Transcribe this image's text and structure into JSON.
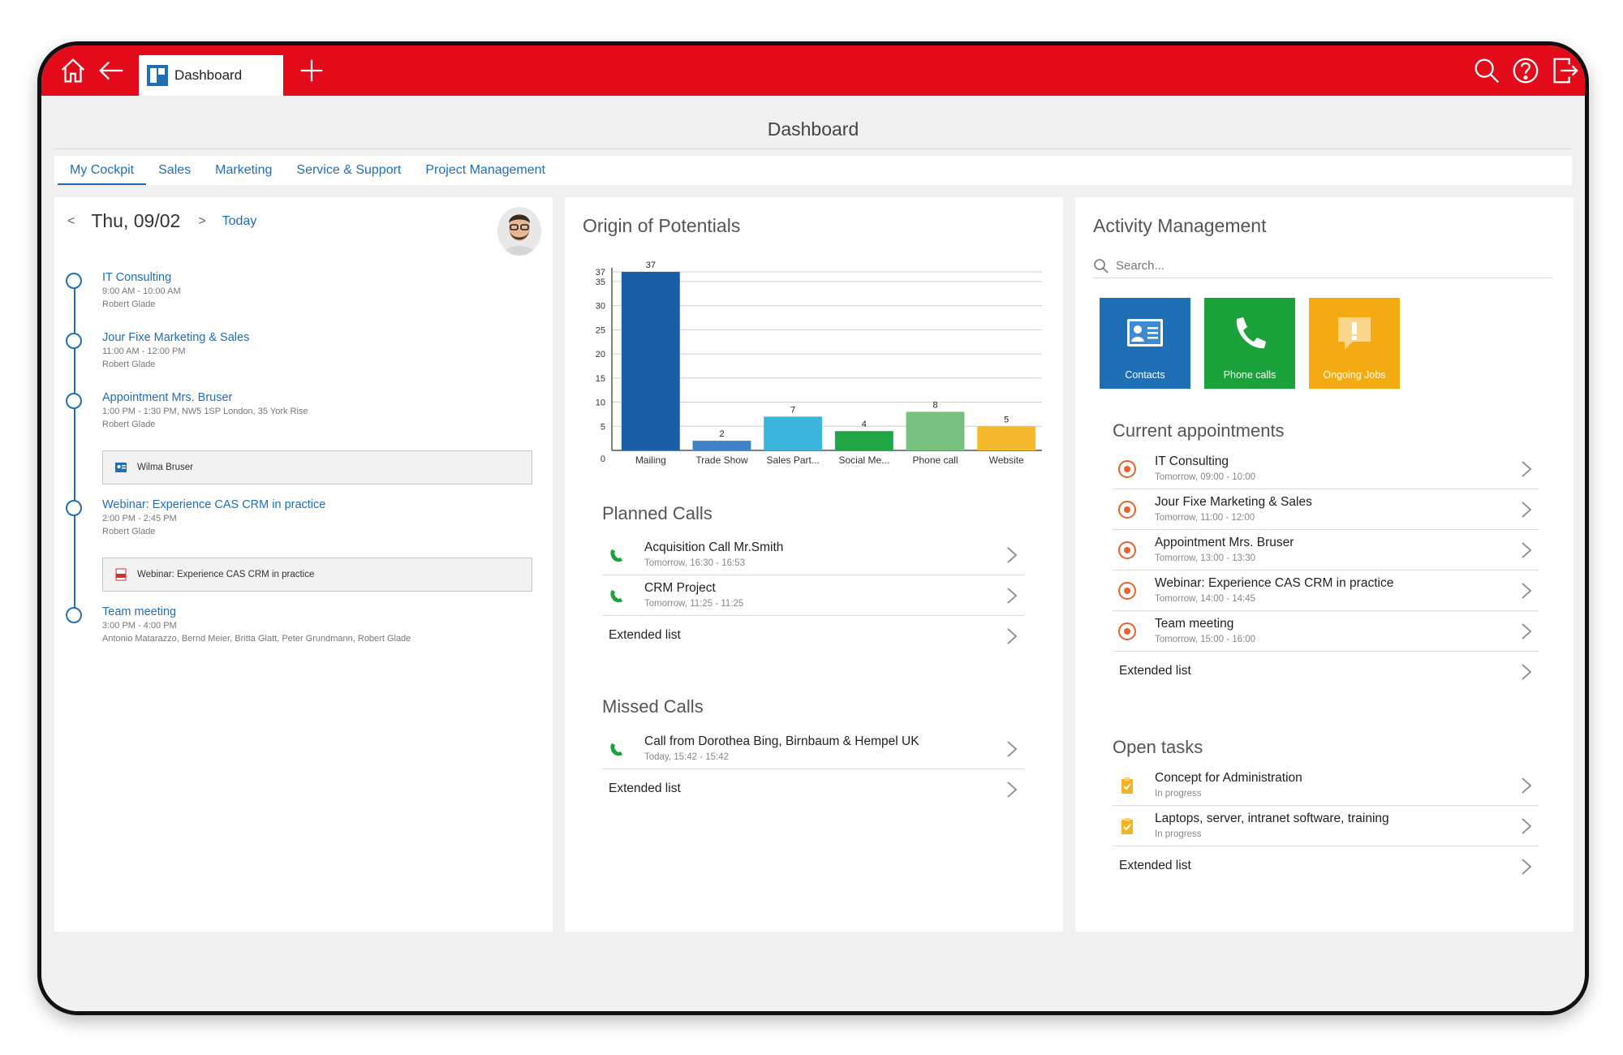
{
  "topbar": {
    "tab_label": "Dashboard",
    "accent": "#e30a1a"
  },
  "page_title": "Dashboard",
  "subnav": [
    "My Cockpit",
    "Sales",
    "Marketing",
    "Service & Support",
    "Project Management"
  ],
  "cockpit": {
    "prev": "<",
    "date": "Thu, 09/02",
    "next": ">",
    "today": "Today",
    "appointments": [
      {
        "title": "IT Consulting",
        "time": "9:00 AM - 10:00 AM",
        "people": "Robert Glade"
      },
      {
        "title": "Jour Fixe Marketing & Sales",
        "time": "11:00 AM - 12:00 PM",
        "people": "Robert Glade"
      },
      {
        "title": "Appointment Mrs. Bruser",
        "time": "1:00 PM - 1:30 PM, NW5 1SP London, 35 York Rise",
        "people": "Robert Glade",
        "attachment": "Wilma Bruser"
      },
      {
        "title": "Webinar: Experience CAS CRM in practice",
        "time": "2:00 PM - 2:45 PM",
        "people": "Robert Glade",
        "attachment": "Webinar: Experience CAS CRM in practice"
      },
      {
        "title": "Team meeting",
        "time": "3:00 PM - 4:00 PM",
        "people": "Antonio Matarazzo,  Bernd Meier,  Britta Glatt,  Peter Grundmann,  Robert Glade"
      }
    ]
  },
  "potentials": {
    "title": "Origin of Potentials",
    "chart_data": {
      "type": "bar",
      "categories": [
        "Mailing",
        "Trade Show",
        "Sales Part...",
        "Social Me...",
        "Phone call",
        "Website"
      ],
      "values": [
        37,
        2,
        7,
        4,
        8,
        5
      ],
      "colors": [
        "#1a5ea8",
        "#3f82c8",
        "#3cb4dc",
        "#21a646",
        "#78c07f",
        "#f5b92e"
      ],
      "y_ticks": [
        "0",
        "5",
        "10",
        "15",
        "20",
        "25",
        "30",
        "35",
        "37"
      ],
      "ylim": [
        0,
        37
      ],
      "grid": true
    }
  },
  "planned_calls": {
    "title": "Planned Calls",
    "items": [
      {
        "title": "Acquisition Call Mr.Smith",
        "sub": "Tomorrow, 16:30 - 16:53"
      },
      {
        "title": "CRM Project",
        "sub": "Tomorrow, 11:25 - 11:25"
      }
    ],
    "extended": "Extended list"
  },
  "missed_calls": {
    "title": "Missed Calls",
    "items": [
      {
        "title": "Call from Dorothea Bing, Birnbaum & Hempel UK",
        "sub": "Today, 15:42 - 15:42"
      }
    ],
    "extended": "Extended list"
  },
  "activity": {
    "title": "Activity Management",
    "search_placeholder": "Search...",
    "tiles": [
      {
        "label": "Contacts",
        "color": "#1f6fb7"
      },
      {
        "label": "Phone calls",
        "color": "#1ba23a"
      },
      {
        "label": "Ongoing Jobs",
        "color": "#f4aa13"
      }
    ]
  },
  "current_appointments": {
    "title": "Current appointments",
    "items": [
      {
        "title": "IT Consulting",
        "sub": "Tomorrow, 09:00 - 10:00"
      },
      {
        "title": "Jour Fixe Marketing & Sales",
        "sub": "Tomorrow, 11:00 - 12:00"
      },
      {
        "title": "Appointment Mrs. Bruser",
        "sub": "Tomorrow, 13:00 - 13:30"
      },
      {
        "title": "Webinar: Experience CAS CRM in practice",
        "sub": "Tomorrow, 14:00 - 14:45"
      },
      {
        "title": "Team meeting",
        "sub": "Tomorrow, 15:00 - 16:00"
      }
    ],
    "extended": "Extended list"
  },
  "open_tasks": {
    "title": "Open tasks",
    "items": [
      {
        "title": "Concept for Administration",
        "sub": "In progress"
      },
      {
        "title": "Laptops, server, intranet software, training",
        "sub": "In progress"
      }
    ],
    "extended": "Extended list"
  }
}
